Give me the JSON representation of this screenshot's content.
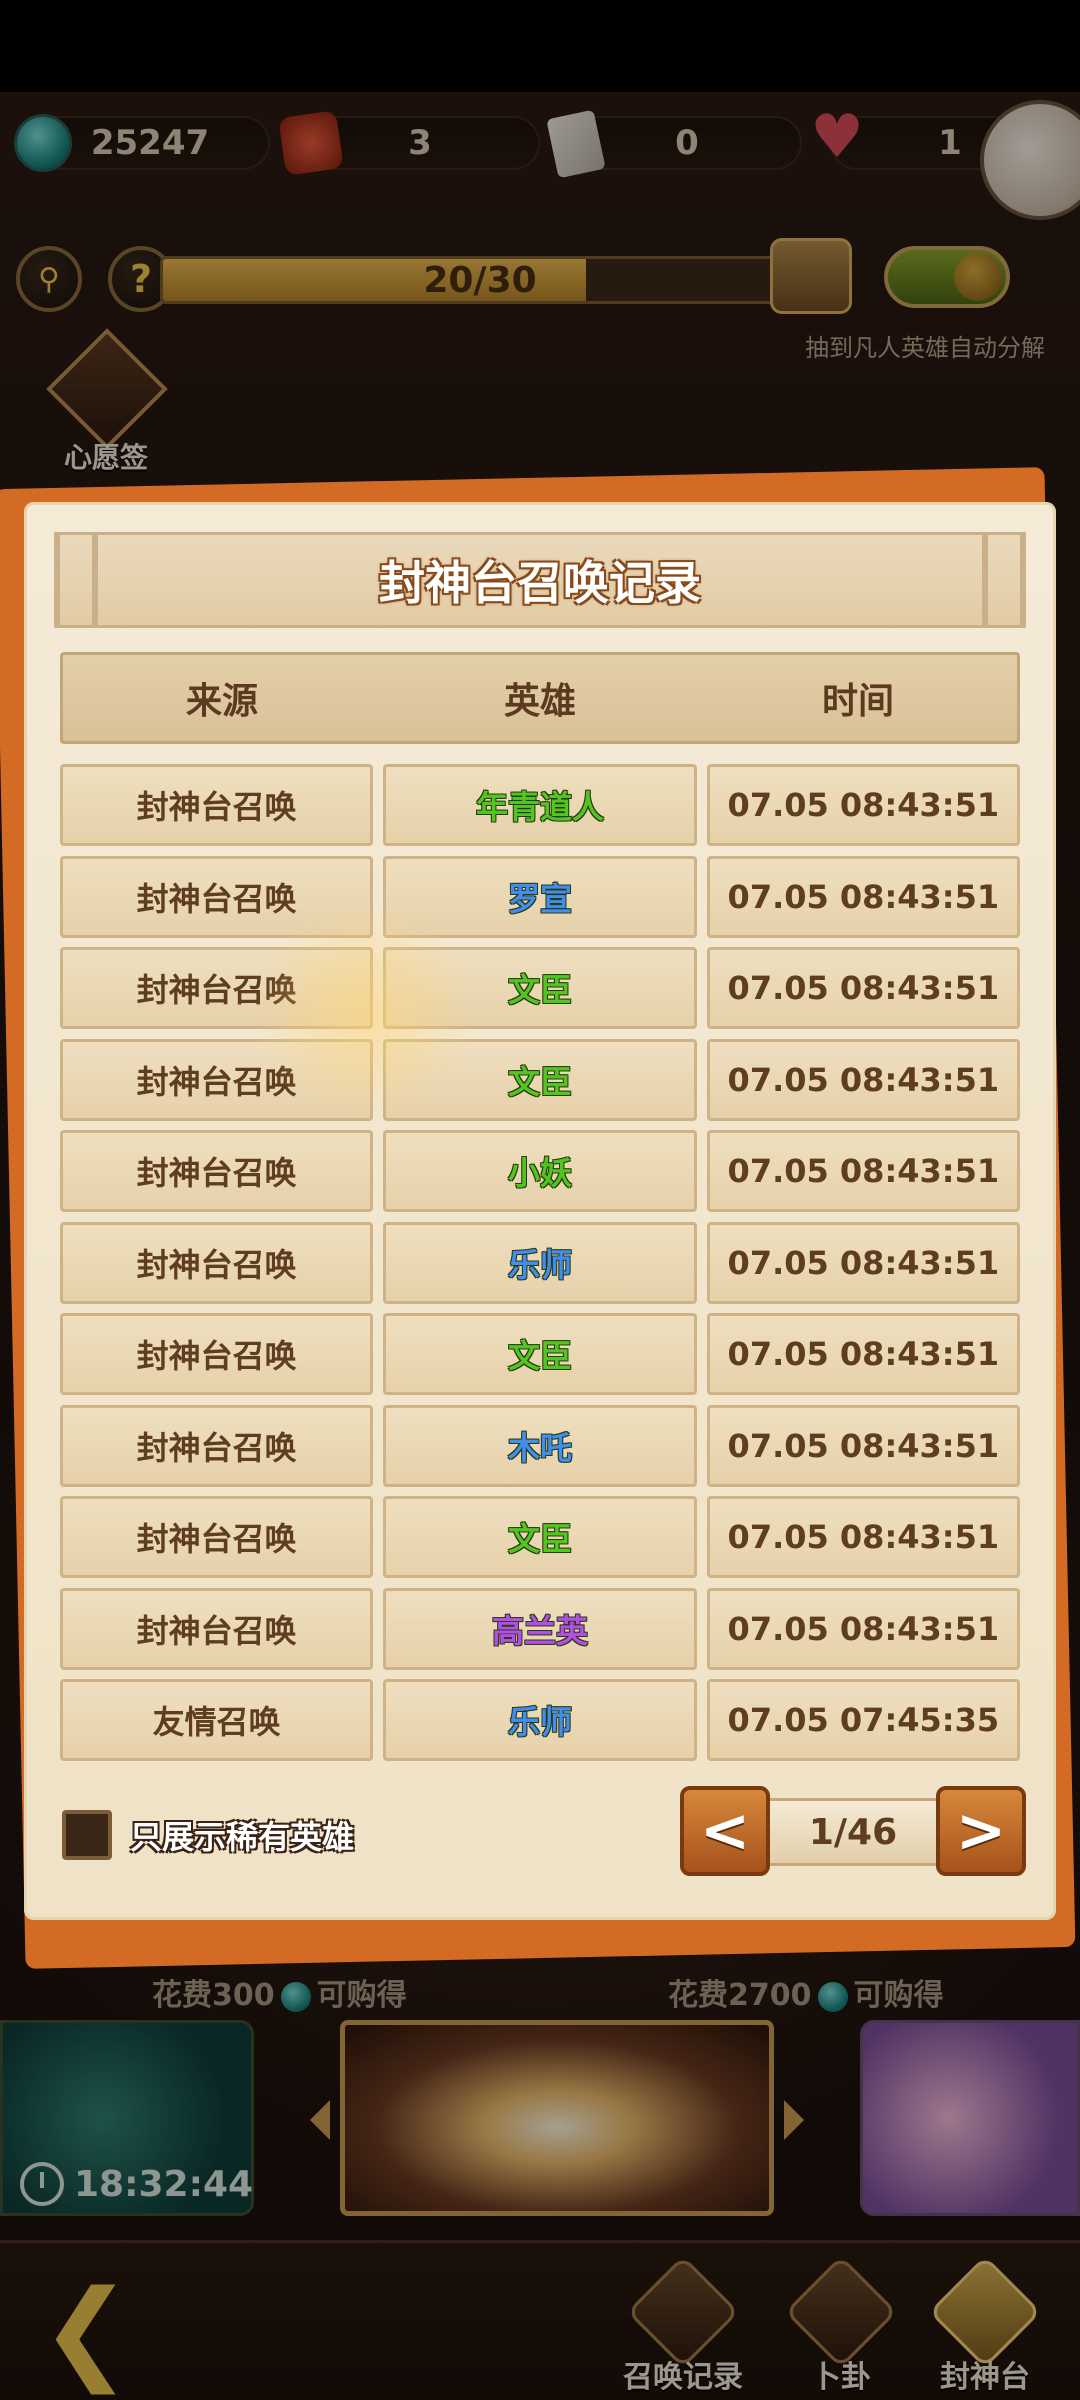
{
  "resources": {
    "gem_count": "25247",
    "token_count": "3",
    "scroll_count": "0",
    "heart_count": "1"
  },
  "toolbar": {
    "progress_text": "20/30",
    "progress_value": 0.667,
    "auto_decompose_label": "抽到凡人英雄自动分解",
    "wish_sign_label": "心愿签"
  },
  "modal": {
    "title": "封神台召唤记录",
    "columns": [
      "来源",
      "英雄",
      "时间"
    ],
    "records": [
      {
        "source": "封神台召唤",
        "hero": "年青道人",
        "hero_color": "#53c520",
        "time": "07.05 08:43:51"
      },
      {
        "source": "封神台召唤",
        "hero": "罗宣",
        "hero_color": "#3f8ef0",
        "time": "07.05 08:43:51"
      },
      {
        "source": "封神台召唤",
        "hero": "文臣",
        "hero_color": "#53c520",
        "time": "07.05 08:43:51"
      },
      {
        "source": "封神台召唤",
        "hero": "文臣",
        "hero_color": "#53c520",
        "time": "07.05 08:43:51"
      },
      {
        "source": "封神台召唤",
        "hero": "小妖",
        "hero_color": "#53c520",
        "time": "07.05 08:43:51"
      },
      {
        "source": "封神台召唤",
        "hero": "乐师",
        "hero_color": "#3f8ef0",
        "time": "07.05 08:43:51"
      },
      {
        "source": "封神台召唤",
        "hero": "文臣",
        "hero_color": "#53c520",
        "time": "07.05 08:43:51"
      },
      {
        "source": "封神台召唤",
        "hero": "木吒",
        "hero_color": "#3f8ef0",
        "time": "07.05 08:43:51"
      },
      {
        "source": "封神台召唤",
        "hero": "文臣",
        "hero_color": "#53c520",
        "time": "07.05 08:43:51"
      },
      {
        "source": "封神台召唤",
        "hero": "高兰英",
        "hero_color": "#b34fe8",
        "time": "07.05 08:43:51"
      },
      {
        "source": "友情召唤",
        "hero": "乐师",
        "hero_color": "#3f8ef0",
        "time": "07.05 07:45:35"
      }
    ],
    "rare_only_label": "只展示稀有英雄",
    "prev_label": "<",
    "next_label": ">",
    "page_indicator": "1/46"
  },
  "shop": {
    "left_price_prefix": "花费300",
    "left_price_suffix": "可购得",
    "right_price_prefix": "花费2700",
    "right_price_suffix": "可购得",
    "timer": "18:32:44"
  },
  "nav": {
    "summon_record": "召唤记录",
    "divination": "卜卦",
    "fengshen": "封神台"
  }
}
